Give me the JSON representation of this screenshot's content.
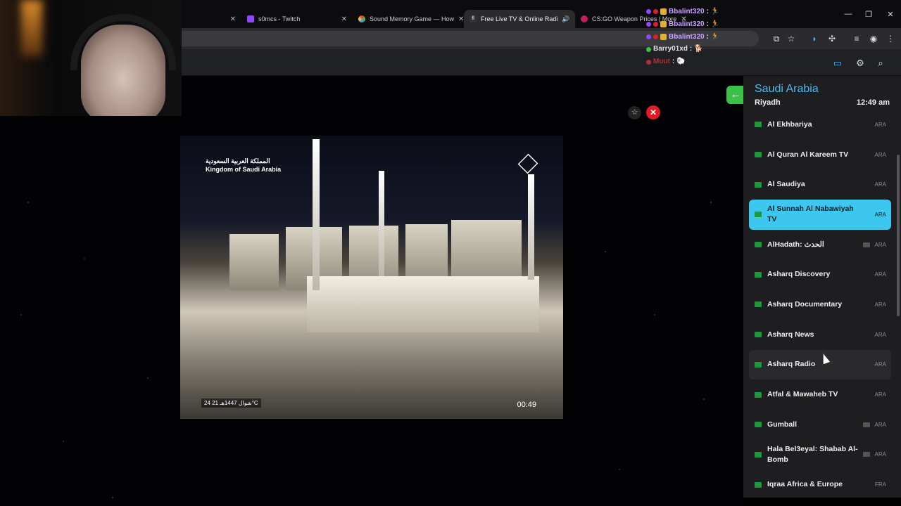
{
  "browser": {
    "tabs": [
      {
        "title": "",
        "active": false
      },
      {
        "title": "s0mcs - Twitch",
        "active": false
      },
      {
        "title": "Sound Memory Game — How",
        "active": false
      },
      {
        "title": "Free Live TV & Online Radi",
        "active": true
      },
      {
        "title": "CS:GO Weapon Prices | More",
        "active": false
      }
    ],
    "window_controls": [
      "—",
      "❐",
      "✕"
    ]
  },
  "chat": [
    {
      "user": "Bbalint320",
      "suffix": ":",
      "emote": "🏃",
      "color": "#c9a0ff"
    },
    {
      "user": "Bbalint320",
      "suffix": ":",
      "emote": "🏃",
      "color": "#c9a0ff"
    },
    {
      "user": "Bbalint320",
      "suffix": ":",
      "emote": "🏃",
      "color": "#c9a0ff"
    },
    {
      "user": "Barry01xd",
      "suffix": ":",
      "emote": "🐕",
      "color": "#e0e0e0"
    },
    {
      "user": "Muut",
      "suffix": ":",
      "emote": "🐑",
      "color": "#b0303a"
    }
  ],
  "video": {
    "overlay_ar": "المملكة العربية السعودية",
    "overlay_en": "Kingdom of Saudi Arabia",
    "clock": "00:49",
    "date": "24 شوال 1447هـ  21°C"
  },
  "sidebar": {
    "country": "Saudi Arabia",
    "city": "Riyadh",
    "time": "12:49 am",
    "channels": [
      {
        "name": "Al Ekhbariya",
        "lang": "ARA",
        "tv": false,
        "selected": false
      },
      {
        "name": "Al Quran Al Kareem TV",
        "lang": "ARA",
        "tv": false,
        "selected": false
      },
      {
        "name": "Al Saudiya",
        "lang": "ARA",
        "tv": false,
        "selected": false
      },
      {
        "name": "Al Sunnah Al Nabawiyah TV",
        "lang": "ARA",
        "tv": false,
        "selected": true
      },
      {
        "name": "AlHadath: الحدث",
        "lang": "ARA",
        "tv": true,
        "selected": false
      },
      {
        "name": "Asharq Discovery",
        "lang": "ARA",
        "tv": false,
        "selected": false
      },
      {
        "name": "Asharq Documentary",
        "lang": "ARA",
        "tv": false,
        "selected": false
      },
      {
        "name": "Asharq News",
        "lang": "ARA",
        "tv": false,
        "selected": false
      },
      {
        "name": "Asharq Radio",
        "lang": "ARA",
        "tv": false,
        "selected": false
      },
      {
        "name": "Atfal & Mawaheb TV",
        "lang": "ARA",
        "tv": false,
        "selected": false
      },
      {
        "name": "Gumball",
        "lang": "ARA",
        "tv": true,
        "selected": false
      },
      {
        "name": "Hala Bel3eyal: Shabab Al-Bomb",
        "lang": "ARA",
        "tv": true,
        "selected": false
      },
      {
        "name": "Iqraa Africa & Europe",
        "lang": "FRA",
        "tv": false,
        "selected": false
      }
    ]
  },
  "colors": {
    "accent_blue": "#3ec7ee",
    "country_title": "#4fb8f0",
    "back_green": "#3bc14a",
    "close_red": "#e01b24"
  }
}
